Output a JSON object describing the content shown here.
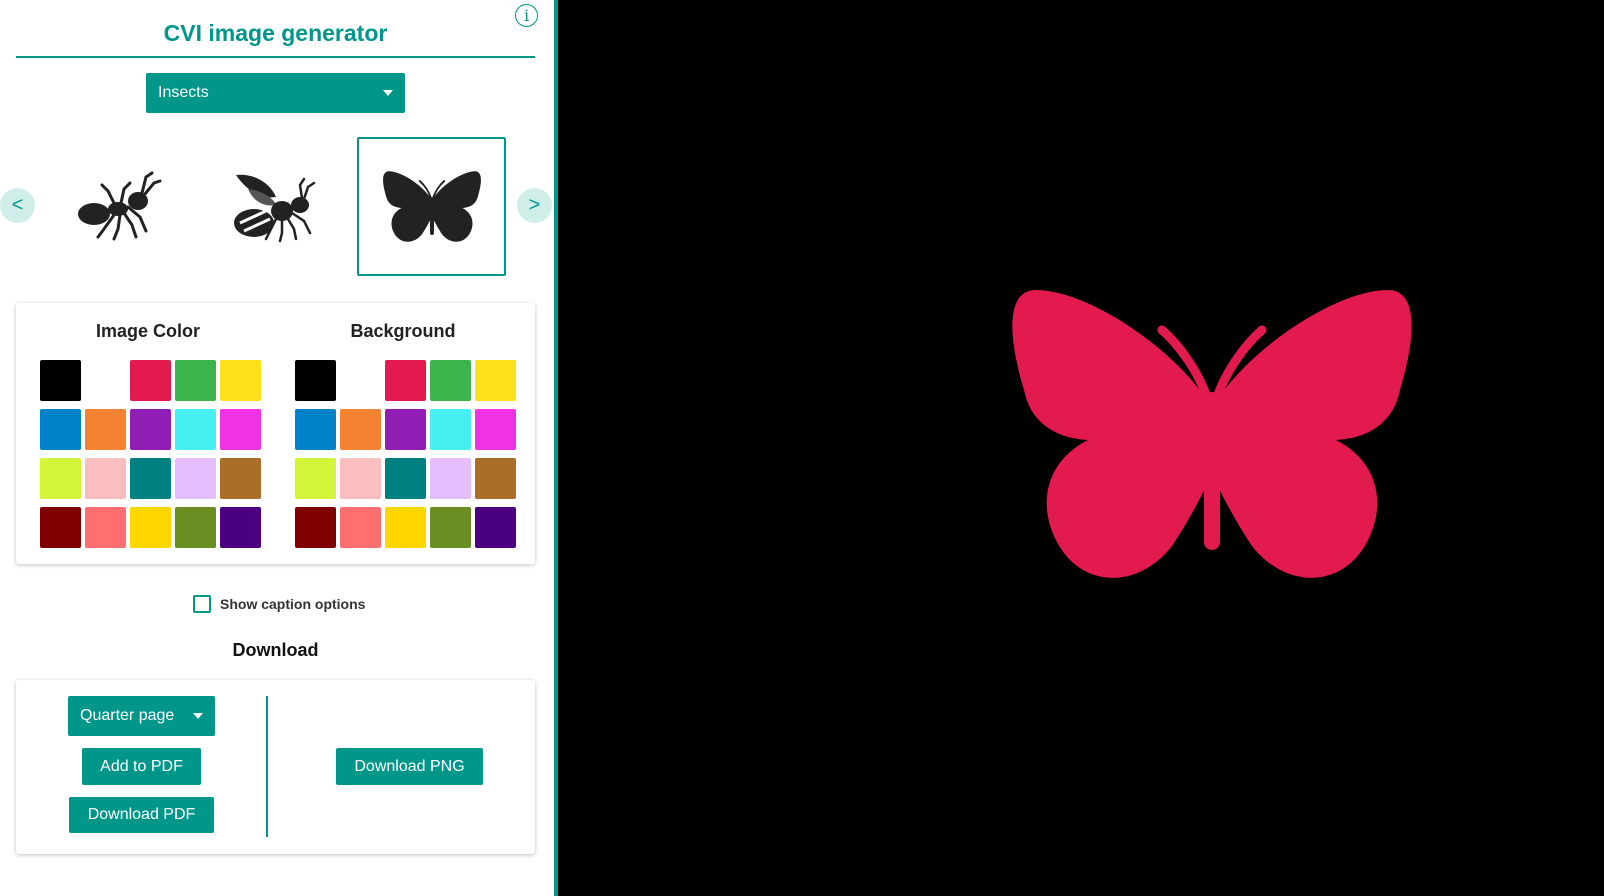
{
  "app": {
    "title": "CVI image generator",
    "info_icon": "info-icon",
    "accent_color": "#00968a"
  },
  "category": {
    "selected": "Insects"
  },
  "carousel": {
    "prev_label": "<",
    "next_label": ">",
    "items": [
      {
        "icon": "ant-icon",
        "selected": false
      },
      {
        "icon": "bee-icon",
        "selected": false
      },
      {
        "icon": "butterfly-icon",
        "selected": true
      }
    ]
  },
  "colors": {
    "image_heading": "Image Color",
    "background_heading": "Background",
    "palette": [
      "#000000",
      "#ffffff",
      "#e31a4d",
      "#3cb44b",
      "#ffe119",
      "#0082c8",
      "#f58231",
      "#911eb4",
      "#46f0f0",
      "#f032e6",
      "#d2f53c",
      "#fabebe",
      "#008080",
      "#e6beff",
      "#aa6e28",
      "#800000",
      "#ff6f6f",
      "#ffd700",
      "#6b8e23",
      "#4b0082"
    ]
  },
  "caption": {
    "label": "Show caption options",
    "checked": false
  },
  "download": {
    "heading": "Download",
    "size_selected": "Quarter page",
    "add_pdf_label": "Add to PDF",
    "download_pdf_label": "Download PDF",
    "download_png_label": "Download PNG"
  },
  "preview": {
    "image_icon": "butterfly-icon",
    "image_color": "#e31a4d",
    "background_color": "#000000"
  }
}
